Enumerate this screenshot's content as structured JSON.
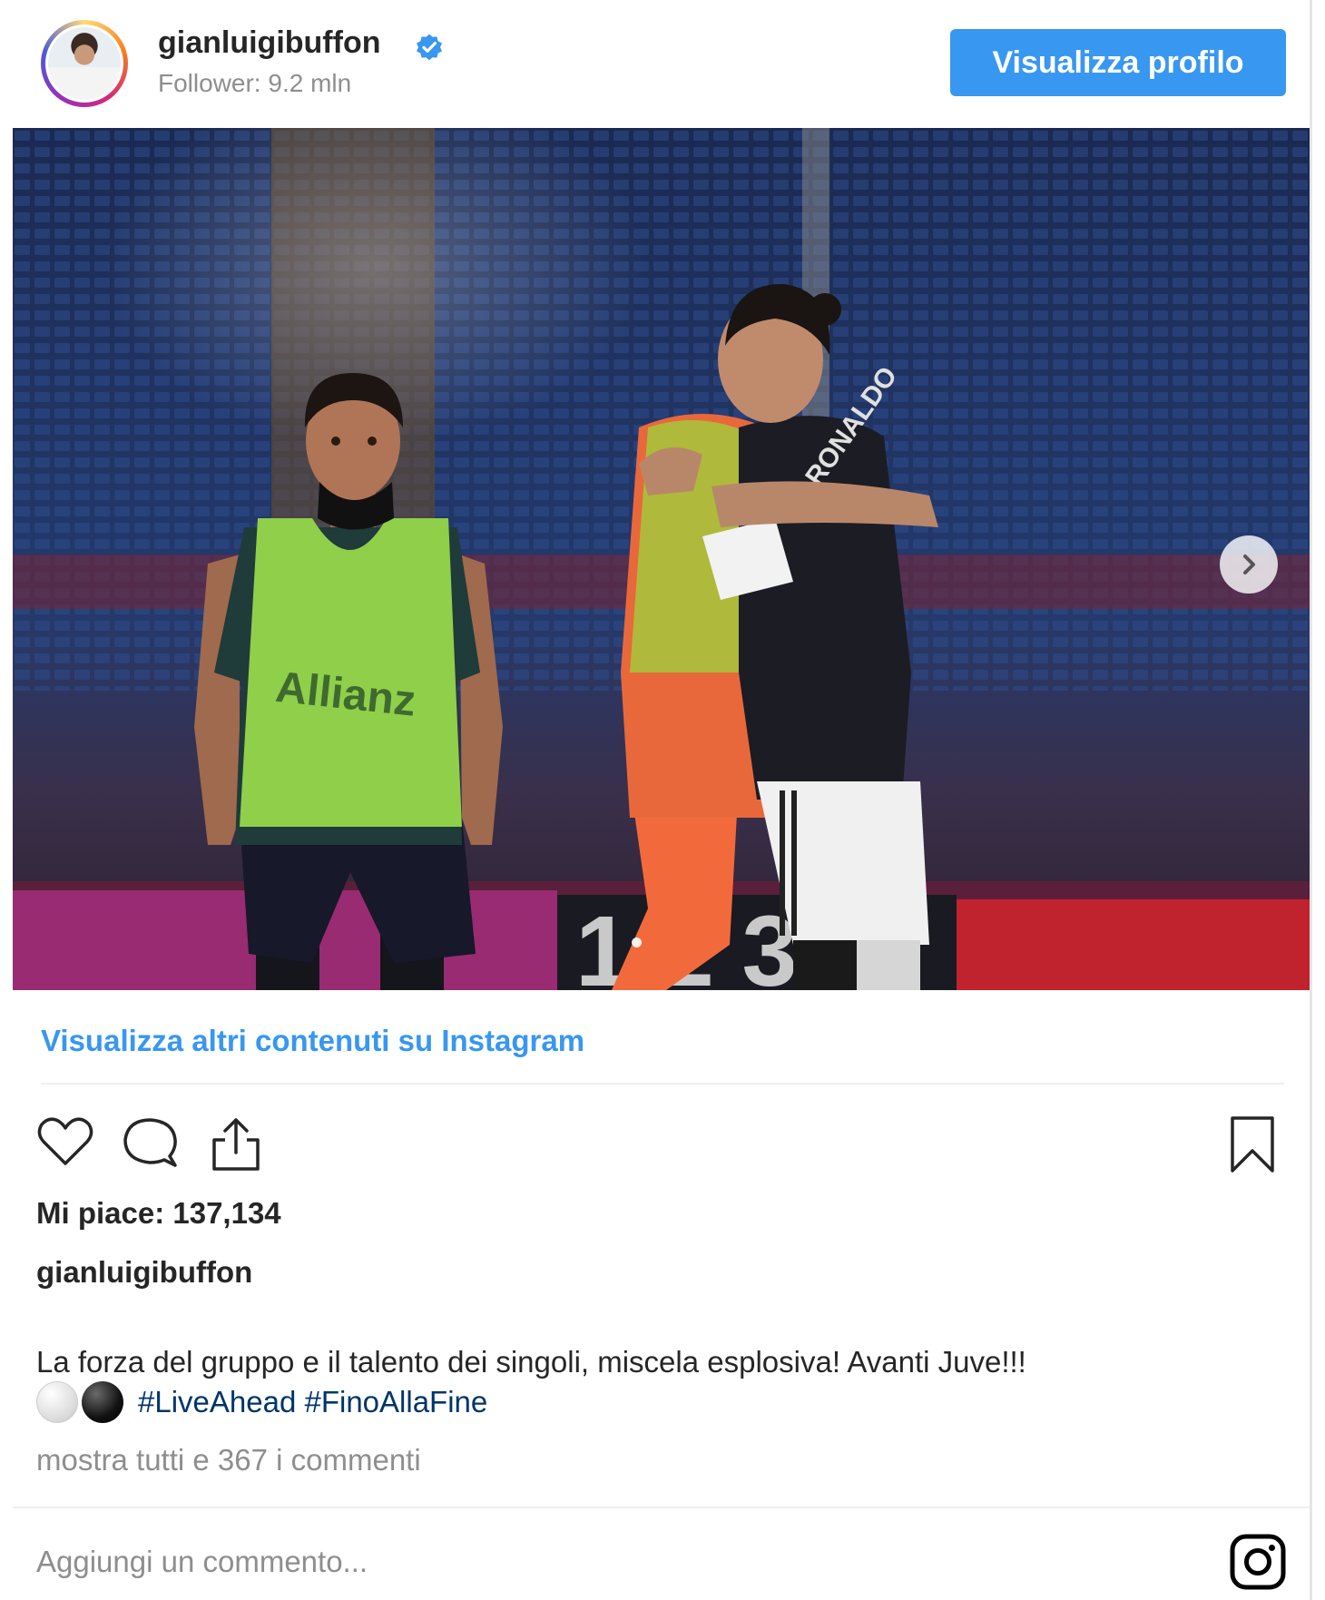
{
  "header": {
    "username": "gianluigibuffon",
    "followers": "Follower: 9.2 mln",
    "view_profile_label": "Visualizza profilo"
  },
  "post": {
    "more_content_link": "Visualizza altri contenuti su Instagram",
    "likes": "Mi piace: 137,134",
    "caption_username": "gianluigibuffon",
    "caption_text": "La forza del gruppo e il talento dei singoli, miscela esplosiva! Avanti Juve!!!",
    "hashtags": "#LiveAhead #FinoAllaFine",
    "view_comments": "mostra tutti e 367 i commenti",
    "comment_placeholder": "Aggiungi un commento..."
  },
  "photo": {
    "bib_text": "Allianz",
    "shirt_text": "RONALDO"
  },
  "colors": {
    "accent": "#3897f0",
    "hashtag": "#003569",
    "muted": "#8e8e8e"
  },
  "icons": [
    "verified-badge-icon",
    "chevron-right-icon",
    "heart-icon",
    "comment-icon",
    "share-icon",
    "bookmark-icon",
    "instagram-logo-icon"
  ]
}
